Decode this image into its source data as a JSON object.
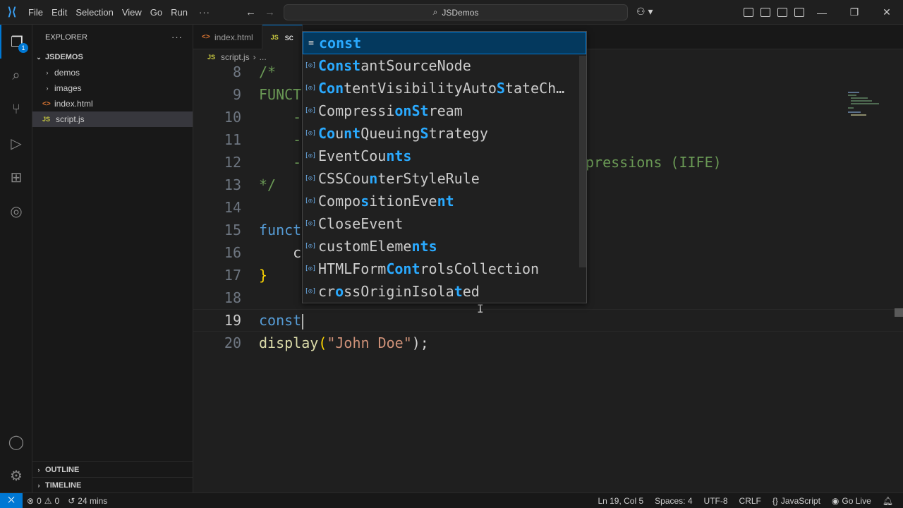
{
  "titlebar": {
    "menu": [
      "File",
      "Edit",
      "Selection",
      "View",
      "Go",
      "Run"
    ],
    "more": "···",
    "search_text": "JSDemos",
    "window_controls": [
      "—",
      "❐",
      "✕"
    ]
  },
  "explorer": {
    "header": "EXPLORER",
    "more": "···",
    "root": "JSDEMOS",
    "items": [
      {
        "label": "demos",
        "kind": "folder"
      },
      {
        "label": "images",
        "kind": "folder"
      },
      {
        "label": "index.html",
        "kind": "html"
      },
      {
        "label": "script.js",
        "kind": "js",
        "selected": true
      }
    ],
    "outline": "OUTLINE",
    "timeline": "TIMELINE"
  },
  "activity_badge": "1",
  "tabs": [
    {
      "label": "index.html",
      "icon": "<>"
    },
    {
      "label": "sc",
      "icon": "JS",
      "active": true
    }
  ],
  "breadcrumb": {
    "file": "script.js",
    "more": "..."
  },
  "code_lines": [
    {
      "n": "8",
      "text": "/*"
    },
    {
      "n": "9",
      "text": "FUNCT"
    },
    {
      "n": "10",
      "text": "    -"
    },
    {
      "n": "11",
      "text": "    -"
    },
    {
      "n": "12",
      "text": "    -",
      "tail": "pressions (IIFE)"
    },
    {
      "n": "13",
      "text": "*/"
    },
    {
      "n": "14",
      "text": ""
    },
    {
      "n": "15",
      "text": "funct"
    },
    {
      "n": "16",
      "text": "    c"
    },
    {
      "n": "17",
      "text": "}"
    },
    {
      "n": "18",
      "text": ""
    },
    {
      "n": "19",
      "text": "const"
    },
    {
      "n": "20",
      "fn": "display",
      "open": "(",
      "str": "\"John Doe\"",
      "close": ");"
    }
  ],
  "suggestions": [
    {
      "parts": [
        [
          "const",
          1
        ]
      ],
      "icon": "keyword"
    },
    {
      "parts": [
        [
          "Const",
          1
        ],
        [
          "antSourceNode",
          0
        ]
      ],
      "icon": "variable"
    },
    {
      "parts": [
        [
          "Con",
          1
        ],
        [
          "tentVisibilityAuto",
          0
        ],
        [
          "S",
          1
        ],
        [
          "tateCh…",
          0
        ]
      ],
      "icon": "variable"
    },
    {
      "parts": [
        [
          "Compressi",
          0
        ],
        [
          "o",
          1
        ],
        [
          "n",
          1
        ],
        [
          "S",
          1
        ],
        [
          "t",
          1
        ],
        [
          "ream",
          0
        ]
      ],
      "icon": "variable"
    },
    {
      "parts": [
        [
          "Co",
          1
        ],
        [
          "u",
          0
        ],
        [
          "nt",
          1
        ],
        [
          "Queuing",
          0
        ],
        [
          "S",
          1
        ],
        [
          "trategy",
          0
        ]
      ],
      "icon": "variable"
    },
    {
      "parts": [
        [
          "EventCo",
          0
        ],
        [
          "u",
          0
        ],
        [
          "nts",
          1
        ]
      ],
      "icon": "variable"
    },
    {
      "parts": [
        [
          "CSSCo",
          0
        ],
        [
          "u",
          0
        ],
        [
          "n",
          1
        ],
        [
          "terStyleRule",
          0
        ]
      ],
      "icon": "variable"
    },
    {
      "parts": [
        [
          "Compo",
          0
        ],
        [
          "s",
          1
        ],
        [
          "itionEve",
          0
        ],
        [
          "nt",
          1
        ]
      ],
      "icon": "variable"
    },
    {
      "parts": [
        [
          "C",
          0
        ],
        [
          "lo",
          0
        ],
        [
          "seEvent",
          0
        ]
      ],
      "icon": "variable"
    },
    {
      "parts": [
        [
          "custo",
          0
        ],
        [
          "m",
          0
        ],
        [
          "Eleme",
          0
        ],
        [
          "nts",
          1
        ]
      ],
      "icon": "variable"
    },
    {
      "parts": [
        [
          "HTMLForm",
          0
        ],
        [
          "Cont",
          1
        ],
        [
          "rolsCollection",
          0
        ]
      ],
      "icon": "variable"
    },
    {
      "parts": [
        [
          "cr",
          0
        ],
        [
          "o",
          1
        ],
        [
          "ssOri",
          0
        ],
        [
          "gin",
          0
        ],
        [
          "Isola",
          0
        ],
        [
          "t",
          1
        ],
        [
          "ed",
          0
        ]
      ],
      "icon": "variable"
    }
  ],
  "status": {
    "errors": "0",
    "warnings": "0",
    "time": "24 mins",
    "position": "Ln 19, Col 5",
    "spaces": "Spaces: 4",
    "encoding": "UTF-8",
    "eol": "CRLF",
    "language": "JavaScript",
    "golive": "Go Live"
  },
  "colors": {
    "accent": "#0078d4",
    "keyword": "#569cd6",
    "comment": "#6a9955",
    "string": "#ce9178",
    "function": "#dcdcaa",
    "match": "#2aaaff"
  }
}
